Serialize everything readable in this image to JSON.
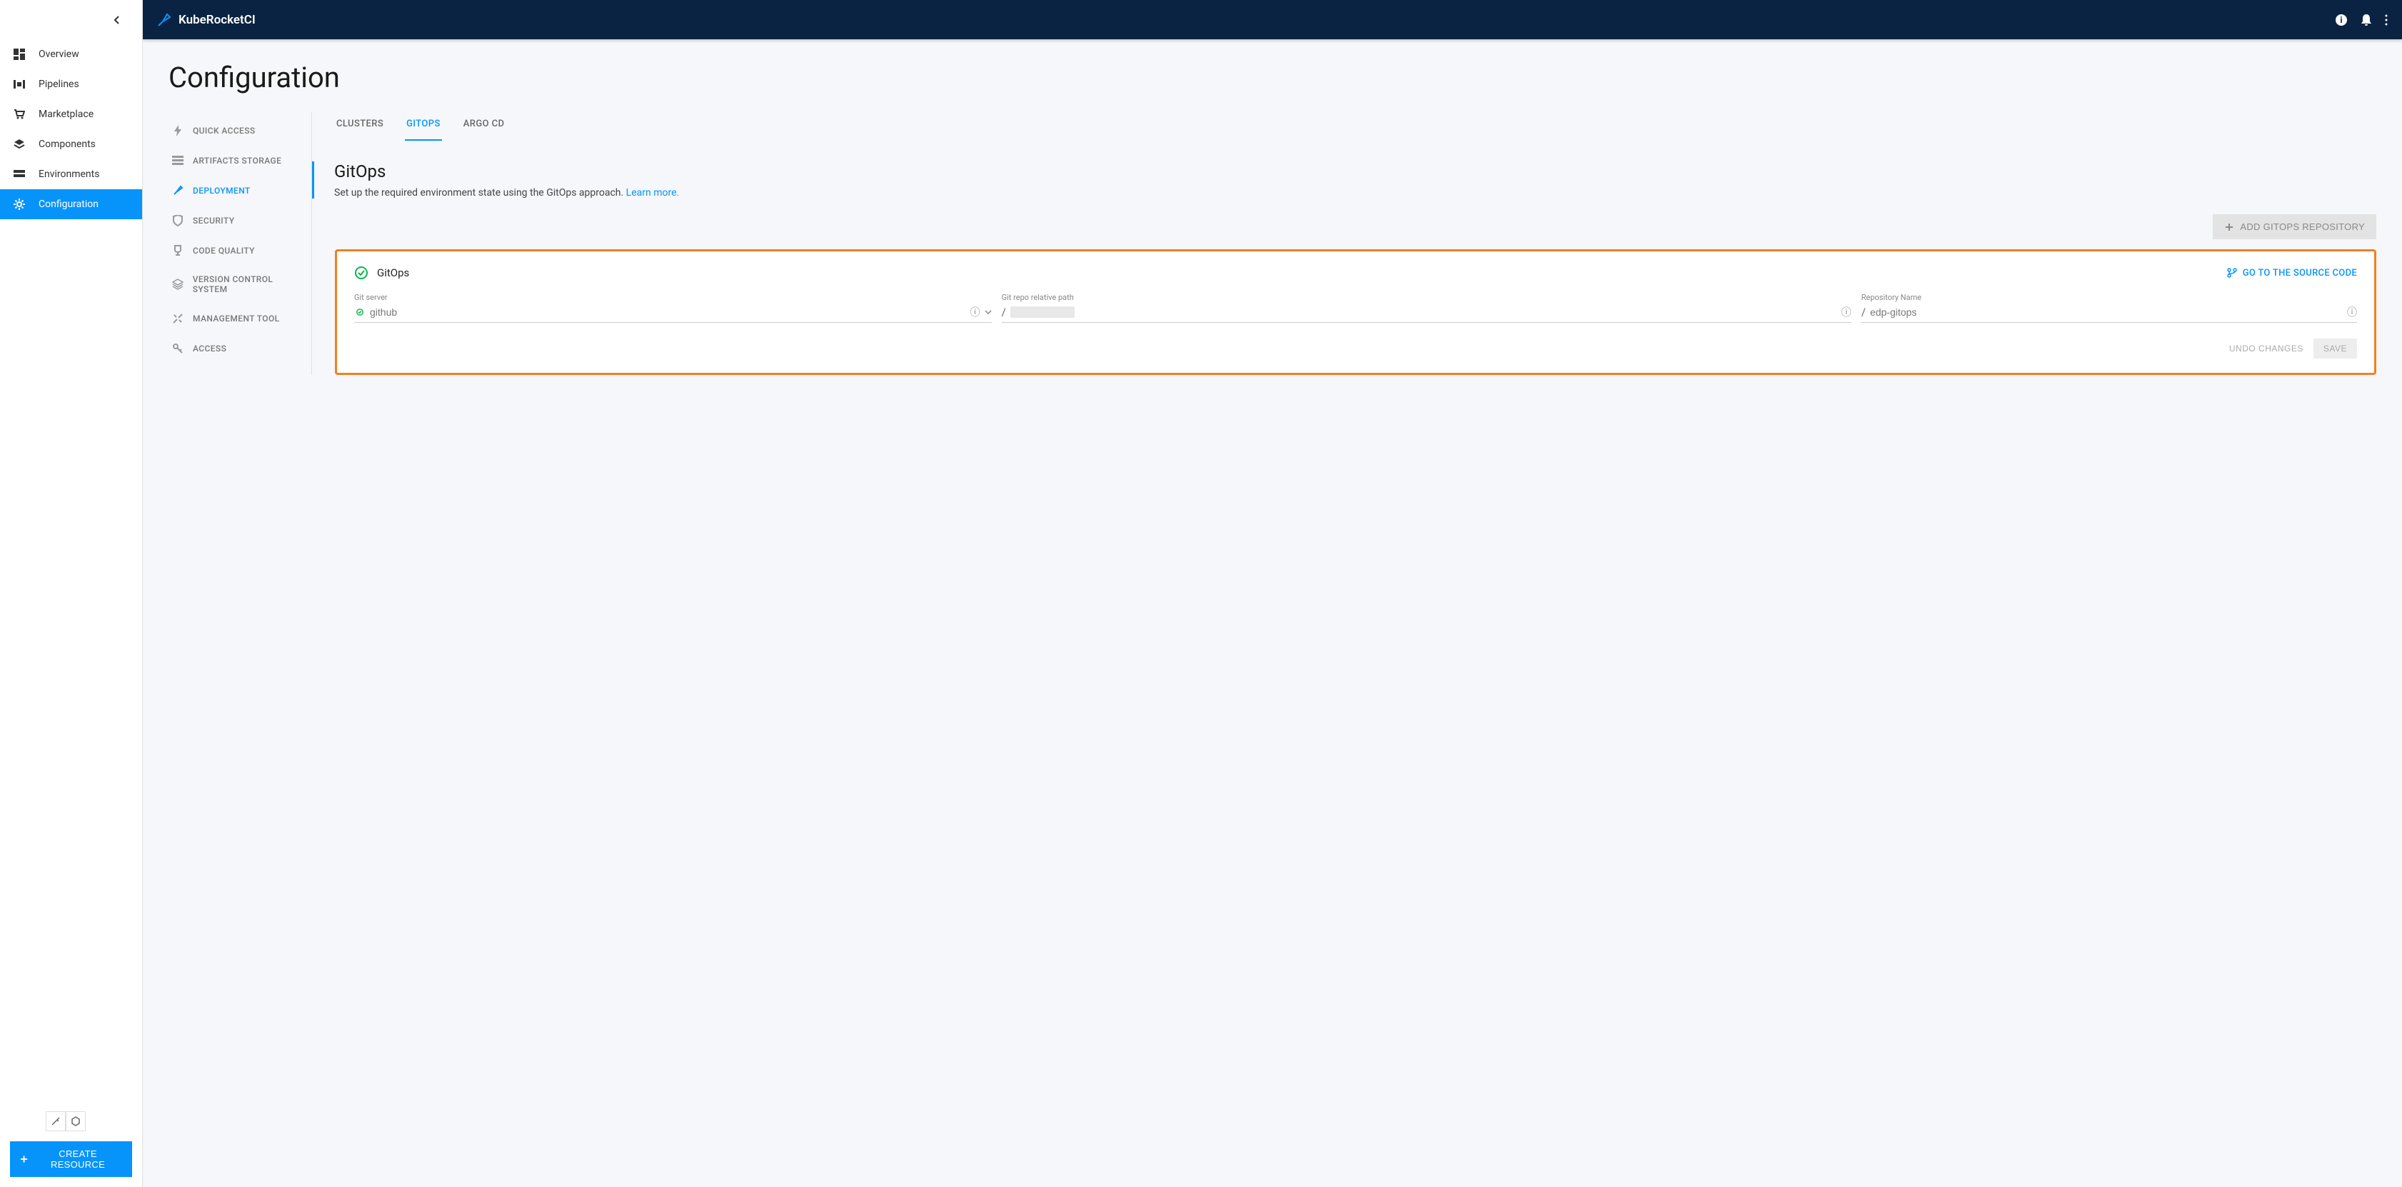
{
  "brand": "KubeRocketCI",
  "sidebar": {
    "items": [
      {
        "label": "Overview"
      },
      {
        "label": "Pipelines"
      },
      {
        "label": "Marketplace"
      },
      {
        "label": "Components"
      },
      {
        "label": "Environments"
      },
      {
        "label": "Configuration"
      }
    ],
    "create_button": "CREATE RESOURCE"
  },
  "page": {
    "title": "Configuration"
  },
  "sub_sidebar": {
    "items": [
      {
        "label": "QUICK ACCESS"
      },
      {
        "label": "ARTIFACTS STORAGE"
      },
      {
        "label": "DEPLOYMENT"
      },
      {
        "label": "SECURITY"
      },
      {
        "label": "CODE QUALITY"
      },
      {
        "label": "VERSION CONTROL SYSTEM"
      },
      {
        "label": "MANAGEMENT TOOL"
      },
      {
        "label": "ACCESS"
      }
    ]
  },
  "tabs": [
    {
      "label": "CLUSTERS"
    },
    {
      "label": "GITOPS"
    },
    {
      "label": "ARGO CD"
    }
  ],
  "section": {
    "title": "GitOps",
    "description": "Set up the required environment state using the GitOps approach.",
    "learn_more": "Learn more."
  },
  "add_button": "ADD GITOPS REPOSITORY",
  "card": {
    "title": "GitOps",
    "source_link": "GO TO THE SOURCE CODE",
    "fields": {
      "git_server": {
        "label": "Git server",
        "value": "github"
      },
      "repo_path": {
        "label": "Git repo relative path",
        "value": ""
      },
      "repo_name": {
        "label": "Repository Name",
        "value": "edp-gitops"
      }
    },
    "undo": "UNDO CHANGES",
    "save": "SAVE"
  }
}
